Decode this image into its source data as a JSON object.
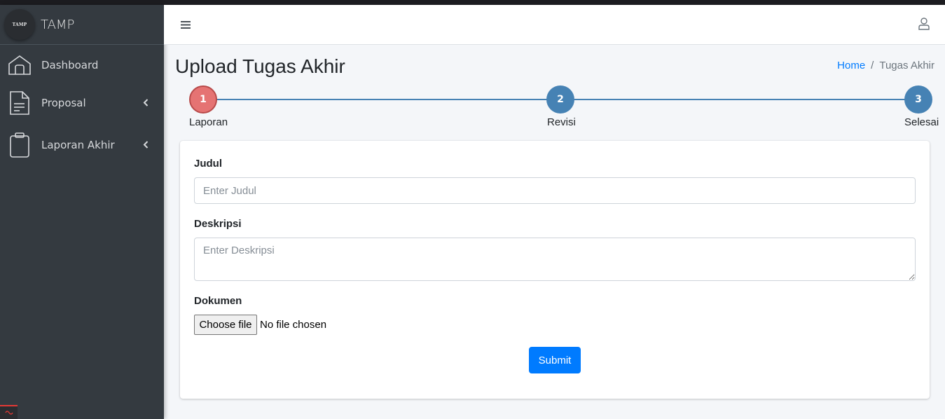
{
  "brand": {
    "logo_text": "TAMP",
    "name": "TAMP"
  },
  "sidebar": {
    "items": [
      {
        "label": "Dashboard",
        "icon": "home-icon"
      },
      {
        "label": "Proposal",
        "icon": "document-icon",
        "has_submenu": true
      },
      {
        "label": "Laporan Akhir",
        "icon": "clipboard-icon",
        "has_submenu": true
      }
    ]
  },
  "header": {
    "menu_icon": "hamburger-icon",
    "user_icon": "user-icon"
  },
  "page": {
    "title": "Upload Tugas Akhir",
    "breadcrumb": {
      "home": "Home",
      "separator": "/",
      "current": "Tugas Akhir"
    }
  },
  "stepper": {
    "steps": [
      {
        "number": "1",
        "label": "Laporan",
        "state": "active"
      },
      {
        "number": "2",
        "label": "Revisi",
        "state": "pending"
      },
      {
        "number": "3",
        "label": "Selesai",
        "state": "pending"
      }
    ]
  },
  "form": {
    "judul": {
      "label": "Judul",
      "placeholder": "Enter Judul",
      "value": ""
    },
    "deskripsi": {
      "label": "Deskripsi",
      "placeholder": "Enter Deskripsi",
      "value": ""
    },
    "dokumen": {
      "label": "Dokumen",
      "button": "Choose file",
      "status": "No file chosen"
    },
    "submit_label": "Submit"
  },
  "colors": {
    "sidebar_bg": "#343a40",
    "step_active": "#e57373",
    "step_pending": "#4682b4",
    "primary": "#007bff"
  }
}
